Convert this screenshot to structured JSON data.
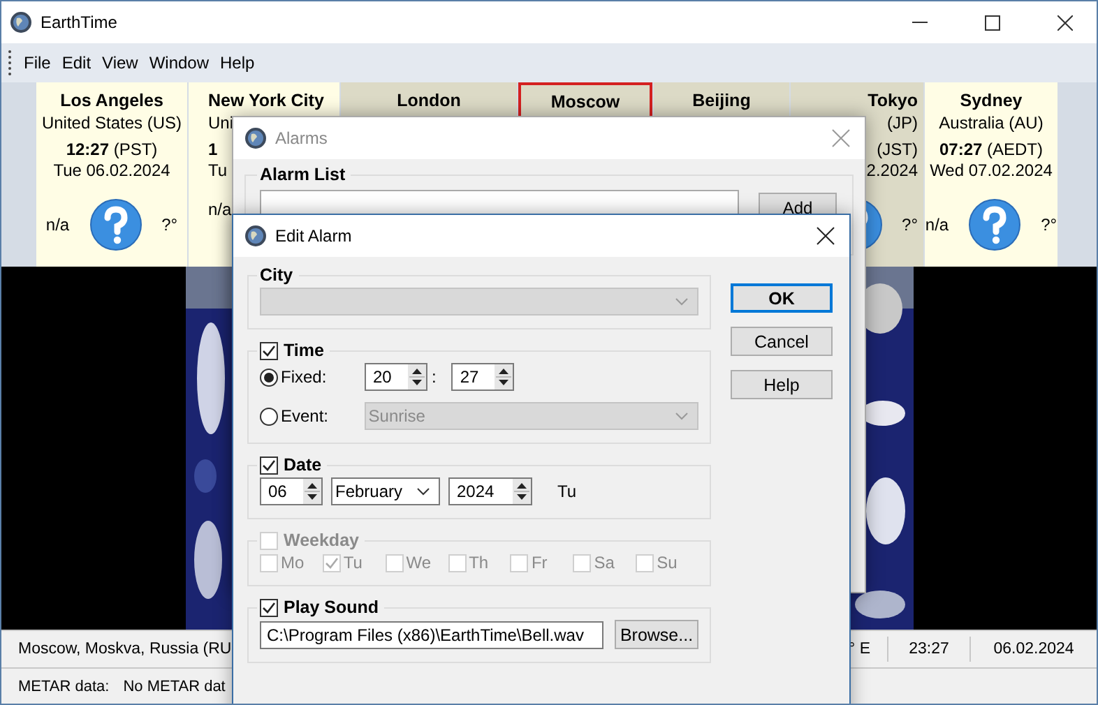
{
  "window": {
    "title": "EarthTime"
  },
  "menu": [
    "File",
    "Edit",
    "View",
    "Window",
    "Help"
  ],
  "cities": [
    {
      "city": "Los Angeles",
      "country": "United States (US)",
      "time": "**12:27** (PST)",
      "date": "Tue 06.02.2024",
      "weather": "n/a",
      "temperature": "?°",
      "daytime": true,
      "selected": false,
      "kind": "full"
    },
    {
      "city": "New York City",
      "country": "Uni",
      "time": "**1**",
      "date": "Tu",
      "weather": "n/a",
      "daytime": true,
      "selected": false,
      "kind": "left"
    },
    {
      "city": "London",
      "daytime": false,
      "selected": false,
      "kind": "top"
    },
    {
      "city": "Moscow",
      "daytime": false,
      "selected": true,
      "kind": "top"
    },
    {
      "city": "Beijing",
      "daytime": false,
      "selected": false,
      "kind": "top"
    },
    {
      "city": "Tokyo",
      "country": "(JP)",
      "time": "(JST)",
      "date": "2.2024",
      "temperature": "?°",
      "daytime": false,
      "selected": false,
      "kind": "right"
    },
    {
      "city": "Sydney",
      "country": "Australia (AU)",
      "time": "**07:27** (AEDT)",
      "date": "Wed 07.02.2024",
      "weather": "n/a",
      "temperature": "?°",
      "daytime": true,
      "selected": false,
      "kind": "full"
    }
  ],
  "status": {
    "location": "Moscow, Moskva, Russia (RU",
    "longitude": "° E",
    "time": "23:27",
    "date": "06.02.2024",
    "metar_label": "METAR data:",
    "metar": "No METAR dat"
  },
  "alarms_dialog": {
    "title": "Alarms",
    "active": false,
    "group": "Alarm List",
    "add_button": "Add"
  },
  "edit_alarm": {
    "title": "Edit Alarm",
    "active": true,
    "city": {
      "label": "City",
      "disabled": true
    },
    "time": {
      "label": "Time",
      "checked": true,
      "options": [
        {
          "label": "Fixed:",
          "selected": true
        },
        {
          "label": "Event:",
          "selected": false
        }
      ],
      "hour": "20",
      "separator": ":",
      "minute": "27",
      "event": {
        "value": "Sunrise",
        "disabled": true
      }
    },
    "date": {
      "label": "Date",
      "checked": true,
      "day": "06",
      "month": "February",
      "year": "2024",
      "weekday": "Tu"
    },
    "weekday": {
      "label": "Weekday",
      "checked": false,
      "disabled": true,
      "days": [
        {
          "label": "Mo",
          "checked": false
        },
        {
          "label": "Tu",
          "checked": true
        },
        {
          "label": "We",
          "checked": false
        },
        {
          "label": "Th",
          "checked": false
        },
        {
          "label": "Fr",
          "checked": false
        },
        {
          "label": "Sa",
          "checked": false
        },
        {
          "label": "Su",
          "checked": false
        }
      ]
    },
    "sound": {
      "label": "Play Sound",
      "checked": true,
      "file": "C:\\Program Files (x86)\\EarthTime\\Bell.wav",
      "browse": "Browse..."
    },
    "buttons": [
      {
        "label": "OK",
        "default": true
      },
      {
        "label": "Cancel",
        "default": false
      },
      {
        "label": "Help",
        "default": false
      }
    ]
  }
}
